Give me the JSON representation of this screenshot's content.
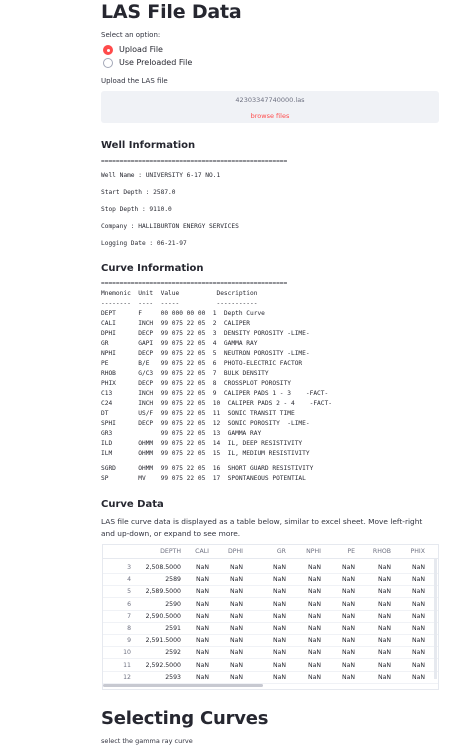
{
  "page_title": "LAS File Data",
  "option_prompt": "Select an option:",
  "options": [
    {
      "label": "Upload File",
      "selected": true
    },
    {
      "label": "Use Preloaded File",
      "selected": false
    }
  ],
  "upload": {
    "label": "Upload the LAS file",
    "file_name": "42303347740000.las",
    "browse_label": "browse files"
  },
  "well_info": {
    "heading": "Well Information",
    "separator": "==================================================",
    "lines": [
      "Well Name : UNIVERSITY 6-17 NO.1",
      "Start Depth : 2587.0",
      "Stop Depth : 9110.0",
      "Company : HALLIBURTON ENERGY SERVICES",
      "Logging Date : 06-21-97"
    ]
  },
  "curve_info": {
    "heading": "Curve Information",
    "separator": "==================================================",
    "header_line": "Mnemonic  Unit  Value          Description",
    "dash_line": "--------  ----  -----          -----------",
    "lines": [
      "DEPT      F     00 000 00 00  1  Depth Curve",
      "CALI      INCH  99 075 22 05  2  CALIPER",
      "DPHI      DECP  99 075 22 05  3  DENSITY POROSITY -LIME-",
      "GR        GAPI  99 075 22 05  4  GAMMA RAY",
      "NPHI      DECP  99 075 22 05  5  NEUTRON POROSITY -LIME-",
      "PE        B/E   99 075 22 05  6  PHOTO-ELECTRIC FACTOR",
      "RHOB      G/C3  99 075 22 05  7  BULK DENSITY",
      "PHIX      DECP  99 075 22 05  8  CROSSPLOT POROSITY",
      "C13       INCH  99 075 22 05  9  CALIPER PADS 1 - 3    -FACT-",
      "C24       INCH  99 075 22 05  10  CALIPER PADS 2 - 4    -FACT-",
      "DT        US/F  99 075 22 05  11  SONIC TRANSIT TIME",
      "SPHI      DECP  99 075 22 05  12  SONIC POROSITY  -LIME-",
      "GR3             99 075 22 05  13  GAMMA RAY",
      "ILD       OHMM  99 075 22 05  14  IL, DEEP RESISTIVITY",
      "ILM       OHMM  99 075 22 05  15  IL, MEDIUM RESISTIVITY",
      "",
      "SGRD      OHMM  99 075 22 05  16  SHORT GUARD RESISTIVITY",
      "SP        MV    99 075 22 05  17  SPONTANEOUS POTENTIAL"
    ]
  },
  "curve_data": {
    "heading": "Curve Data",
    "description": "LAS file curve data is displayed as a table below, similar to excel sheet. Move left-right and up-down, or expand to see more.",
    "columns": [
      "DEPTH",
      "CALI",
      "DPHI",
      "GR",
      "NPHI",
      "PE",
      "RHOB",
      "PHIX"
    ],
    "rows": [
      {
        "index": "3",
        "depth": "2,508.5000",
        "values": [
          "NaN",
          "NaN",
          "NaN",
          "NaN",
          "NaN",
          "NaN",
          "NaN"
        ]
      },
      {
        "index": "4",
        "depth": "2589",
        "values": [
          "NaN",
          "NaN",
          "NaN",
          "NaN",
          "NaN",
          "NaN",
          "NaN"
        ]
      },
      {
        "index": "5",
        "depth": "2,589.5000",
        "values": [
          "NaN",
          "NaN",
          "NaN",
          "NaN",
          "NaN",
          "NaN",
          "NaN"
        ]
      },
      {
        "index": "6",
        "depth": "2590",
        "values": [
          "NaN",
          "NaN",
          "NaN",
          "NaN",
          "NaN",
          "NaN",
          "NaN"
        ]
      },
      {
        "index": "7",
        "depth": "2,590.5000",
        "values": [
          "NaN",
          "NaN",
          "NaN",
          "NaN",
          "NaN",
          "NaN",
          "NaN"
        ]
      },
      {
        "index": "8",
        "depth": "2591",
        "values": [
          "NaN",
          "NaN",
          "NaN",
          "NaN",
          "NaN",
          "NaN",
          "NaN"
        ]
      },
      {
        "index": "9",
        "depth": "2,591.5000",
        "values": [
          "NaN",
          "NaN",
          "NaN",
          "NaN",
          "NaN",
          "NaN",
          "NaN"
        ]
      },
      {
        "index": "10",
        "depth": "2592",
        "values": [
          "NaN",
          "NaN",
          "NaN",
          "NaN",
          "NaN",
          "NaN",
          "NaN"
        ]
      },
      {
        "index": "11",
        "depth": "2,592.5000",
        "values": [
          "NaN",
          "NaN",
          "NaN",
          "NaN",
          "NaN",
          "NaN",
          "NaN"
        ]
      },
      {
        "index": "12",
        "depth": "2593",
        "values": [
          "NaN",
          "NaN",
          "NaN",
          "NaN",
          "NaN",
          "NaN",
          "NaN"
        ]
      }
    ]
  },
  "selecting": {
    "heading": "Selecting Curves",
    "label": "select the gamma ray curve"
  },
  "colors": {
    "accent": "#ff4b4b",
    "upload_bg": "#f0f2f6",
    "text": "#262730"
  }
}
